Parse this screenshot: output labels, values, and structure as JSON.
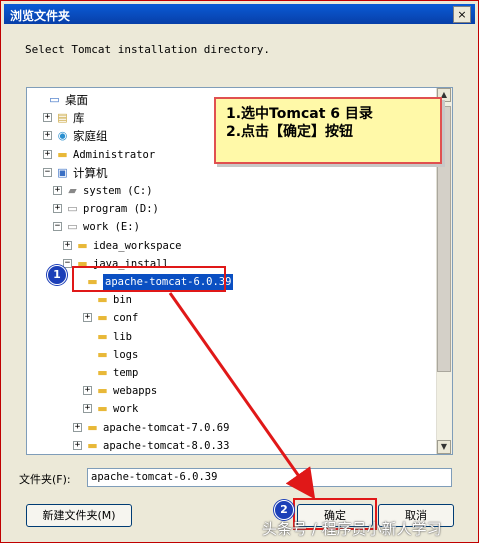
{
  "window": {
    "title": "浏览文件夹",
    "close_label": "×"
  },
  "prompt": "Select Tomcat installation directory.",
  "tree": [
    {
      "label": "桌面",
      "indent": 0,
      "icon": "desktop-icon",
      "glyph": "▭",
      "cjk": true,
      "expander": ""
    },
    {
      "label": "库",
      "indent": 1,
      "icon": "library-icon",
      "glyph": "▤",
      "cjk": true,
      "expander": "+"
    },
    {
      "label": "家庭组",
      "indent": 1,
      "icon": "homegroup-icon",
      "glyph": "◉",
      "cjk": true,
      "expander": "+"
    },
    {
      "label": "Administrator",
      "indent": 1,
      "icon": "user-folder-icon",
      "glyph": "▬",
      "cjk": false,
      "expander": "+"
    },
    {
      "label": "计算机",
      "indent": 1,
      "icon": "computer-icon",
      "glyph": "▣",
      "cjk": true,
      "expander": "−"
    },
    {
      "label": "system (C:)",
      "indent": 2,
      "icon": "system-drive-icon",
      "glyph": "▰",
      "cjk": false,
      "expander": "+"
    },
    {
      "label": "program (D:)",
      "indent": 2,
      "icon": "drive-icon",
      "glyph": "▭",
      "cjk": false,
      "expander": "+"
    },
    {
      "label": "work (E:)",
      "indent": 2,
      "icon": "drive-icon",
      "glyph": "▭",
      "cjk": false,
      "expander": "−"
    },
    {
      "label": "idea_workspace",
      "indent": 3,
      "icon": "folder-icon",
      "glyph": "▬",
      "cjk": false,
      "expander": "+"
    },
    {
      "label": "java_install",
      "indent": 3,
      "icon": "folder-icon",
      "glyph": "▬",
      "cjk": false,
      "expander": "−"
    },
    {
      "label": "apache-tomcat-6.0.39",
      "indent": 4,
      "icon": "folder-icon",
      "glyph": "▬",
      "cjk": false,
      "expander": "",
      "selected": true
    },
    {
      "label": "bin",
      "indent": 5,
      "icon": "folder-icon",
      "glyph": "▬",
      "cjk": false,
      "expander": ""
    },
    {
      "label": "conf",
      "indent": 5,
      "icon": "folder-icon",
      "glyph": "▬",
      "cjk": false,
      "expander": "+"
    },
    {
      "label": "lib",
      "indent": 5,
      "icon": "folder-icon",
      "glyph": "▬",
      "cjk": false,
      "expander": ""
    },
    {
      "label": "logs",
      "indent": 5,
      "icon": "folder-icon",
      "glyph": "▬",
      "cjk": false,
      "expander": ""
    },
    {
      "label": "temp",
      "indent": 5,
      "icon": "folder-icon",
      "glyph": "▬",
      "cjk": false,
      "expander": ""
    },
    {
      "label": "webapps",
      "indent": 5,
      "icon": "folder-icon",
      "glyph": "▬",
      "cjk": false,
      "expander": "+"
    },
    {
      "label": "work",
      "indent": 5,
      "icon": "folder-icon",
      "glyph": "▬",
      "cjk": false,
      "expander": "+"
    },
    {
      "label": "apache-tomcat-7.0.69",
      "indent": 4,
      "icon": "folder-icon",
      "glyph": "▬",
      "cjk": false,
      "expander": "+"
    },
    {
      "label": "apache-tomcat-8.0.33",
      "indent": 4,
      "icon": "folder-icon",
      "glyph": "▬",
      "cjk": false,
      "expander": "+"
    }
  ],
  "annotation": {
    "line1": "1.选中Tomcat 6 目录",
    "line2": "2.点击【确定】按钮",
    "badge1": "1",
    "badge2": "2"
  },
  "folder_field": {
    "label": "文件夹(F):",
    "value": "apache-tomcat-6.0.39"
  },
  "buttons": {
    "new_folder": "新建文件夹(M)",
    "ok": "确定",
    "cancel": "取消"
  },
  "watermark": "头条号 / 程序员小新人学习",
  "colors": {
    "accent_red": "#e01818",
    "selection_blue": "#0a4fc2",
    "note_yellow": "#fff9a8"
  }
}
